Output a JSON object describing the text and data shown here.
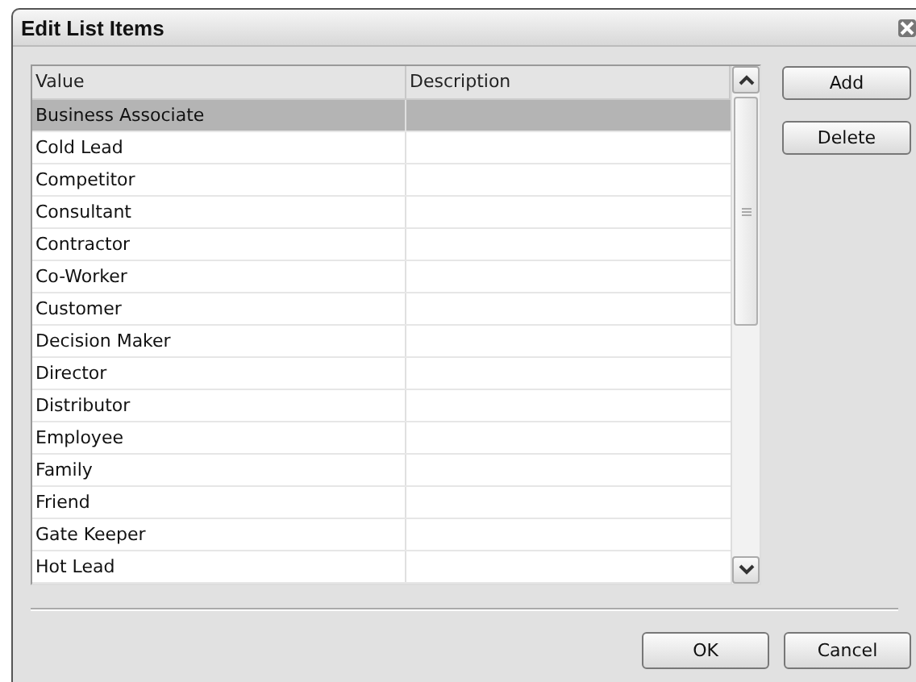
{
  "window": {
    "title": "Edit List Items"
  },
  "table": {
    "columns": [
      "Value",
      "Description"
    ],
    "rows": [
      {
        "value": "Business Associate",
        "selected": true
      },
      {
        "value": "Cold Lead",
        "selected": false
      },
      {
        "value": "Competitor",
        "selected": false
      },
      {
        "value": "Consultant",
        "selected": false
      },
      {
        "value": "Contractor",
        "selected": false
      },
      {
        "value": "Co-Worker",
        "selected": false
      },
      {
        "value": "Customer",
        "selected": false
      },
      {
        "value": "Decision Maker",
        "selected": false
      },
      {
        "value": "Director",
        "selected": false
      },
      {
        "value": "Distributor",
        "selected": false
      },
      {
        "value": "Employee",
        "selected": false
      },
      {
        "value": "Family",
        "selected": false
      },
      {
        "value": "Friend",
        "selected": false
      },
      {
        "value": "Gate Keeper",
        "selected": false
      },
      {
        "value": "Hot Lead",
        "selected": false
      }
    ]
  },
  "side_buttons": [
    "Add",
    "Delete"
  ],
  "buttons": [
    "OK",
    "Cancel"
  ]
}
